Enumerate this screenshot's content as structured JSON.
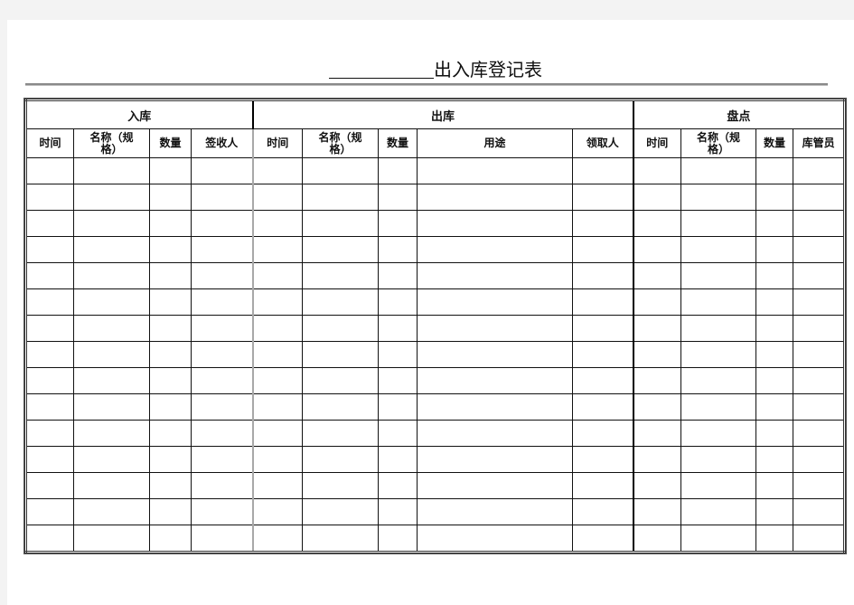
{
  "document": {
    "title_blank": "",
    "title": "出入库登记表"
  },
  "table": {
    "groups": [
      {
        "label": "入库",
        "span": 4
      },
      {
        "label": "出库",
        "span": 5
      },
      {
        "label": "盘点",
        "span": 4
      }
    ],
    "columns": [
      "时间",
      "名称（规格）",
      "数量",
      "签收人",
      "时间",
      "名称（规格）",
      "数量",
      "用途",
      "领取人",
      "时间",
      "名称（规格）",
      "数量",
      "库管员"
    ],
    "rows": [
      [
        "",
        "",
        "",
        "",
        "",
        "",
        "",
        "",
        "",
        "",
        "",
        "",
        ""
      ],
      [
        "",
        "",
        "",
        "",
        "",
        "",
        "",
        "",
        "",
        "",
        "",
        "",
        ""
      ],
      [
        "",
        "",
        "",
        "",
        "",
        "",
        "",
        "",
        "",
        "",
        "",
        "",
        ""
      ],
      [
        "",
        "",
        "",
        "",
        "",
        "",
        "",
        "",
        "",
        "",
        "",
        "",
        ""
      ],
      [
        "",
        "",
        "",
        "",
        "",
        "",
        "",
        "",
        "",
        "",
        "",
        "",
        ""
      ],
      [
        "",
        "",
        "",
        "",
        "",
        "",
        "",
        "",
        "",
        "",
        "",
        "",
        ""
      ],
      [
        "",
        "",
        "",
        "",
        "",
        "",
        "",
        "",
        "",
        "",
        "",
        "",
        ""
      ],
      [
        "",
        "",
        "",
        "",
        "",
        "",
        "",
        "",
        "",
        "",
        "",
        "",
        ""
      ],
      [
        "",
        "",
        "",
        "",
        "",
        "",
        "",
        "",
        "",
        "",
        "",
        "",
        ""
      ],
      [
        "",
        "",
        "",
        "",
        "",
        "",
        "",
        "",
        "",
        "",
        "",
        "",
        ""
      ],
      [
        "",
        "",
        "",
        "",
        "",
        "",
        "",
        "",
        "",
        "",
        "",
        "",
        ""
      ],
      [
        "",
        "",
        "",
        "",
        "",
        "",
        "",
        "",
        "",
        "",
        "",
        "",
        ""
      ],
      [
        "",
        "",
        "",
        "",
        "",
        "",
        "",
        "",
        "",
        "",
        "",
        "",
        ""
      ],
      [
        "",
        "",
        "",
        "",
        "",
        "",
        "",
        "",
        "",
        "",
        "",
        "",
        ""
      ],
      [
        "",
        "",
        "",
        "",
        "",
        "",
        "",
        "",
        "",
        "",
        "",
        "",
        ""
      ]
    ]
  }
}
